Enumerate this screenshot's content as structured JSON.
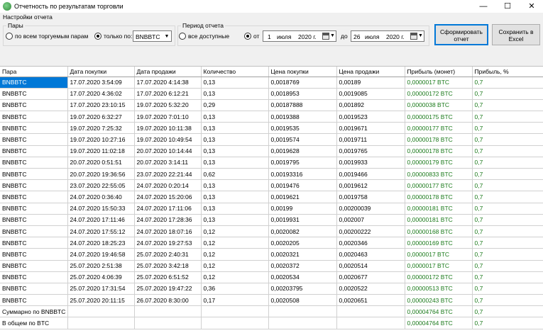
{
  "window": {
    "title": "Отчетность по результатам торговли",
    "min_glyph": "—",
    "max_glyph": "☐",
    "close_glyph": "✕"
  },
  "settings": {
    "label": "Настройки отчета",
    "pairs": {
      "label": "Пары",
      "all_pairs_label": "по всем торгуемым парам",
      "only_label": "только по:",
      "selected_option": "only",
      "pair_value": "BNBBTC"
    },
    "period": {
      "label": "Период отчета",
      "all_label": "все доступные",
      "from_label": "от",
      "to_label": "до",
      "selected_option": "from",
      "from_date": {
        "day": "1",
        "month": "июля",
        "year": "2020 г."
      },
      "to_date": {
        "day": "26",
        "month": "июля",
        "year": "2020 г."
      }
    },
    "generate_button": "Сформировать отчет",
    "save_button": "Сохранить в Excel"
  },
  "table": {
    "columns": [
      "Пара",
      "Дата покупки",
      "Дата продажи",
      "Количество",
      "Цена покупки",
      "Цена продажи",
      "Прибыль (монет)",
      "Прибыль, %"
    ],
    "rows": [
      [
        "BNBBTC",
        "17.07.2020 3:54:09",
        "17.07.2020 4:14:38",
        "0,13",
        "0,0018769",
        "0,00189",
        "0,0000017 BTC",
        "0,7"
      ],
      [
        "BNBBTC",
        "17.07.2020 4:36:02",
        "17.07.2020 6:12:21",
        "0,13",
        "0,0018953",
        "0,0019085",
        "0,00000172 BTC",
        "0,7"
      ],
      [
        "BNBBTC",
        "17.07.2020 23:10:15",
        "19.07.2020 5:32:20",
        "0,29",
        "0,00187888",
        "0,001892",
        "0,0000038 BTC",
        "0,7"
      ],
      [
        "BNBBTC",
        "19.07.2020 6:32:27",
        "19.07.2020 7:01:10",
        "0,13",
        "0,0019388",
        "0,0019523",
        "0,00000175 BTC",
        "0,7"
      ],
      [
        "BNBBTC",
        "19.07.2020 7:25:32",
        "19.07.2020 10:11:38",
        "0,13",
        "0,0019535",
        "0,0019671",
        "0,00000177 BTC",
        "0,7"
      ],
      [
        "BNBBTC",
        "19.07.2020 10:27:16",
        "19.07.2020 10:49:54",
        "0,13",
        "0,0019574",
        "0,0019711",
        "0,00000178 BTC",
        "0,7"
      ],
      [
        "BNBBTC",
        "19.07.2020 11:02:18",
        "20.07.2020 10:14:44",
        "0,13",
        "0,0019628",
        "0,0019765",
        "0,00000178 BTC",
        "0,7"
      ],
      [
        "BNBBTC",
        "20.07.2020 0:51:51",
        "20.07.2020 3:14:11",
        "0,13",
        "0,0019795",
        "0,0019933",
        "0,00000179 BTC",
        "0,7"
      ],
      [
        "BNBBTC",
        "20.07.2020 19:36:56",
        "23.07.2020 22:21:44",
        "0,62",
        "0,00193316",
        "0,0019466",
        "0,00000833 BTC",
        "0,7"
      ],
      [
        "BNBBTC",
        "23.07.2020 22:55:05",
        "24.07.2020 0:20:14",
        "0,13",
        "0,0019476",
        "0,0019612",
        "0,00000177 BTC",
        "0,7"
      ],
      [
        "BNBBTC",
        "24.07.2020 0:36:40",
        "24.07.2020 15:20:06",
        "0,13",
        "0,0019621",
        "0,0019758",
        "0,00000178 BTC",
        "0,7"
      ],
      [
        "BNBBTC",
        "24.07.2020 15:50:33",
        "24.07.2020 17:11:06",
        "0,13",
        "0,00199",
        "0,00200039",
        "0,00000181 BTC",
        "0,7"
      ],
      [
        "BNBBTC",
        "24.07.2020 17:11:46",
        "24.07.2020 17:28:36",
        "0,13",
        "0,0019931",
        "0,002007",
        "0,00000181 BTC",
        "0,7"
      ],
      [
        "BNBBTC",
        "24.07.2020 17:55:12",
        "24.07.2020 18:07:16",
        "0,12",
        "0,0020082",
        "0,00200222",
        "0,00000168 BTC",
        "0,7"
      ],
      [
        "BNBBTC",
        "24.07.2020 18:25:23",
        "24.07.2020 19:27:53",
        "0,12",
        "0,0020205",
        "0,0020346",
        "0,00000169 BTC",
        "0,7"
      ],
      [
        "BNBBTC",
        "24.07.2020 19:46:58",
        "25.07.2020 2:40:31",
        "0,12",
        "0,0020321",
        "0,0020463",
        "0,0000017 BTC",
        "0,7"
      ],
      [
        "BNBBTC",
        "25.07.2020 2:51:38",
        "25.07.2020 3:42:18",
        "0,12",
        "0,0020372",
        "0,0020514",
        "0,0000017 BTC",
        "0,7"
      ],
      [
        "BNBBTC",
        "25.07.2020 4:06:39",
        "25.07.2020 6:51:52",
        "0,12",
        "0,0020534",
        "0,0020677",
        "0,00000172 BTC",
        "0,7"
      ],
      [
        "BNBBTC",
        "25.07.2020 17:31:54",
        "25.07.2020 19:47:22",
        "0,36",
        "0,00203795",
        "0,0020522",
        "0,00000513 BTC",
        "0,7"
      ],
      [
        "BNBBTC",
        "25.07.2020 20:11:15",
        "26.07.2020 8:30:00",
        "0,17",
        "0,0020508",
        "0,0020651",
        "0,00000243 BTC",
        "0,7"
      ],
      [
        "Суммарно по BNBBTC",
        "",
        "",
        "",
        "",
        "",
        "0,00004764 BTC",
        "0,7"
      ],
      [
        "В общем по BTC",
        "",
        "",
        "",
        "",
        "",
        "0,00004764 BTC",
        "0,7"
      ]
    ]
  }
}
